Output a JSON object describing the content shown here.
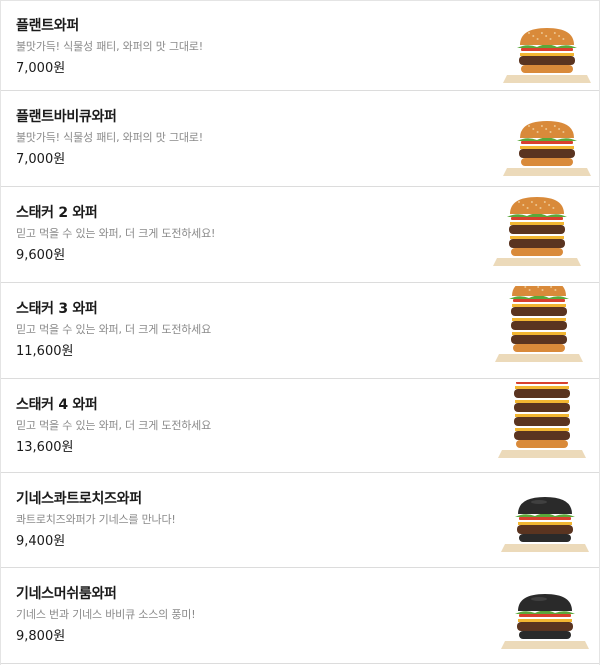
{
  "menu": {
    "items": [
      {
        "name": "플랜트와퍼",
        "desc": "불맛가득! 식물성 패티, 와퍼의 맛 그대로!",
        "price": "7,000원",
        "image_icon": "burger-icon",
        "bun": "sesame",
        "patties": 1
      },
      {
        "name": "플랜트바비큐와퍼",
        "desc": "불맛가득! 식물성 패티, 와퍼의 맛 그대로!",
        "price": "7,000원",
        "image_icon": "burger-icon",
        "bun": "sesame",
        "patties": 1
      },
      {
        "name": "스태커 2 와퍼",
        "desc": "믿고 먹을 수 있는 와퍼, 더 크게 도전하세요!",
        "price": "9,600원",
        "image_icon": "burger-icon",
        "bun": "sesame",
        "patties": 2
      },
      {
        "name": "스태커 3 와퍼",
        "desc": "믿고 먹을 수 있는 와퍼, 더 크게 도전하세요",
        "price": "11,600원",
        "image_icon": "burger-icon",
        "bun": "sesame",
        "patties": 3
      },
      {
        "name": "스태커 4 와퍼",
        "desc": "믿고 먹을 수 있는 와퍼, 더 크게 도전하세요",
        "price": "13,600원",
        "image_icon": "burger-icon",
        "bun": "sesame",
        "patties": 4
      },
      {
        "name": "기네스콰트로치즈와퍼",
        "desc": "콰트로치즈와퍼가 기네스를 만나다!",
        "price": "9,400원",
        "image_icon": "burger-icon",
        "bun": "black",
        "patties": 1
      },
      {
        "name": "기네스머쉬룸와퍼",
        "desc": "기네스 번과 기네스 바비큐 소스의 풍미!",
        "price": "9,800원",
        "image_icon": "burger-icon",
        "bun": "black",
        "patties": 1
      }
    ]
  },
  "colors": {
    "sesame_bun": "#d98a3a",
    "black_bun": "#2a2a2a",
    "patty": "#5a3420",
    "lettuce": "#5aa83a",
    "tomato": "#d8402e",
    "cheese": "#f2b632",
    "tray": "#e9d4ae"
  }
}
